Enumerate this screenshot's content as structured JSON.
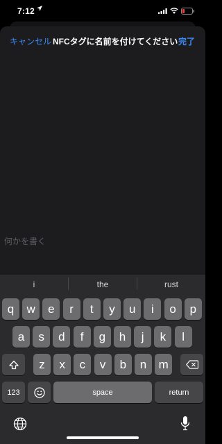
{
  "status_bar": {
    "time": "7:12"
  },
  "header": {
    "cancel_label": "キャンセル",
    "title": "NFCタグに名前を付けてください",
    "done_label": "完了"
  },
  "editor": {
    "placeholder": "何かを書く"
  },
  "keyboard": {
    "suggestions": [
      "i",
      "the",
      "rust"
    ],
    "row1": [
      "q",
      "w",
      "e",
      "r",
      "t",
      "y",
      "u",
      "i",
      "o",
      "p"
    ],
    "row2": [
      "a",
      "s",
      "d",
      "f",
      "g",
      "h",
      "j",
      "k",
      "l"
    ],
    "row3": [
      "z",
      "x",
      "c",
      "v",
      "b",
      "n",
      "m"
    ],
    "numbers_label": "123",
    "space_label": "space",
    "return_label": "return"
  },
  "colors": {
    "accent": "#3b8cf6",
    "sheet_bg": "#1c1c1e",
    "key_bg": "#6c6c6e",
    "key_dark_bg": "#464648",
    "battery_low": "#ff3b30"
  }
}
